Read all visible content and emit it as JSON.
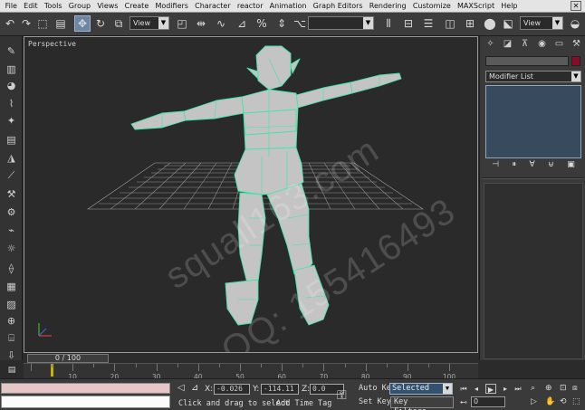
{
  "menu": {
    "items": [
      "File",
      "Edit",
      "Tools",
      "Group",
      "Views",
      "Create",
      "Modifiers",
      "Character",
      "reactor",
      "Animation",
      "Graph Editors",
      "Rendering",
      "Customize",
      "MAXScript",
      "Help"
    ]
  },
  "toolbar": {
    "view_dropdown": "View",
    "selection_set": "",
    "view_dropdown_right": "View"
  },
  "viewport": {
    "label": "Perspective",
    "watermark_line1": "squall163.com",
    "watermark_line2": "QQ: 155416493"
  },
  "command_panel": {
    "object_name": "",
    "object_color": "#8a0b26",
    "modifier_list_label": "Modifier List"
  },
  "timeline": {
    "frame_counter": "0 / 100",
    "ruler_labels": [
      "0",
      "10",
      "20",
      "30",
      "40",
      "50",
      "60",
      "70",
      "80",
      "90",
      "100"
    ]
  },
  "status": {
    "x_label": "X:",
    "x_value": "-0.026",
    "y_label": "Y:",
    "y_value": "-114.11",
    "z_label": "Z:",
    "z_value": "0.0",
    "prompt_text": "Click and drag to select",
    "add_time_tag": "Add Time Tag",
    "auto_key_label": "Auto Key",
    "set_key_label": "Set Key",
    "auto_key_mode": "Selected",
    "key_filters": "Key Filters...",
    "current_frame": "0"
  },
  "colors": {
    "mesh_fill": "#c4c4c4",
    "mesh_wire": "#3fe6a7",
    "selection_highlight": "#33506f",
    "color_swatch": "#8a0b26"
  }
}
